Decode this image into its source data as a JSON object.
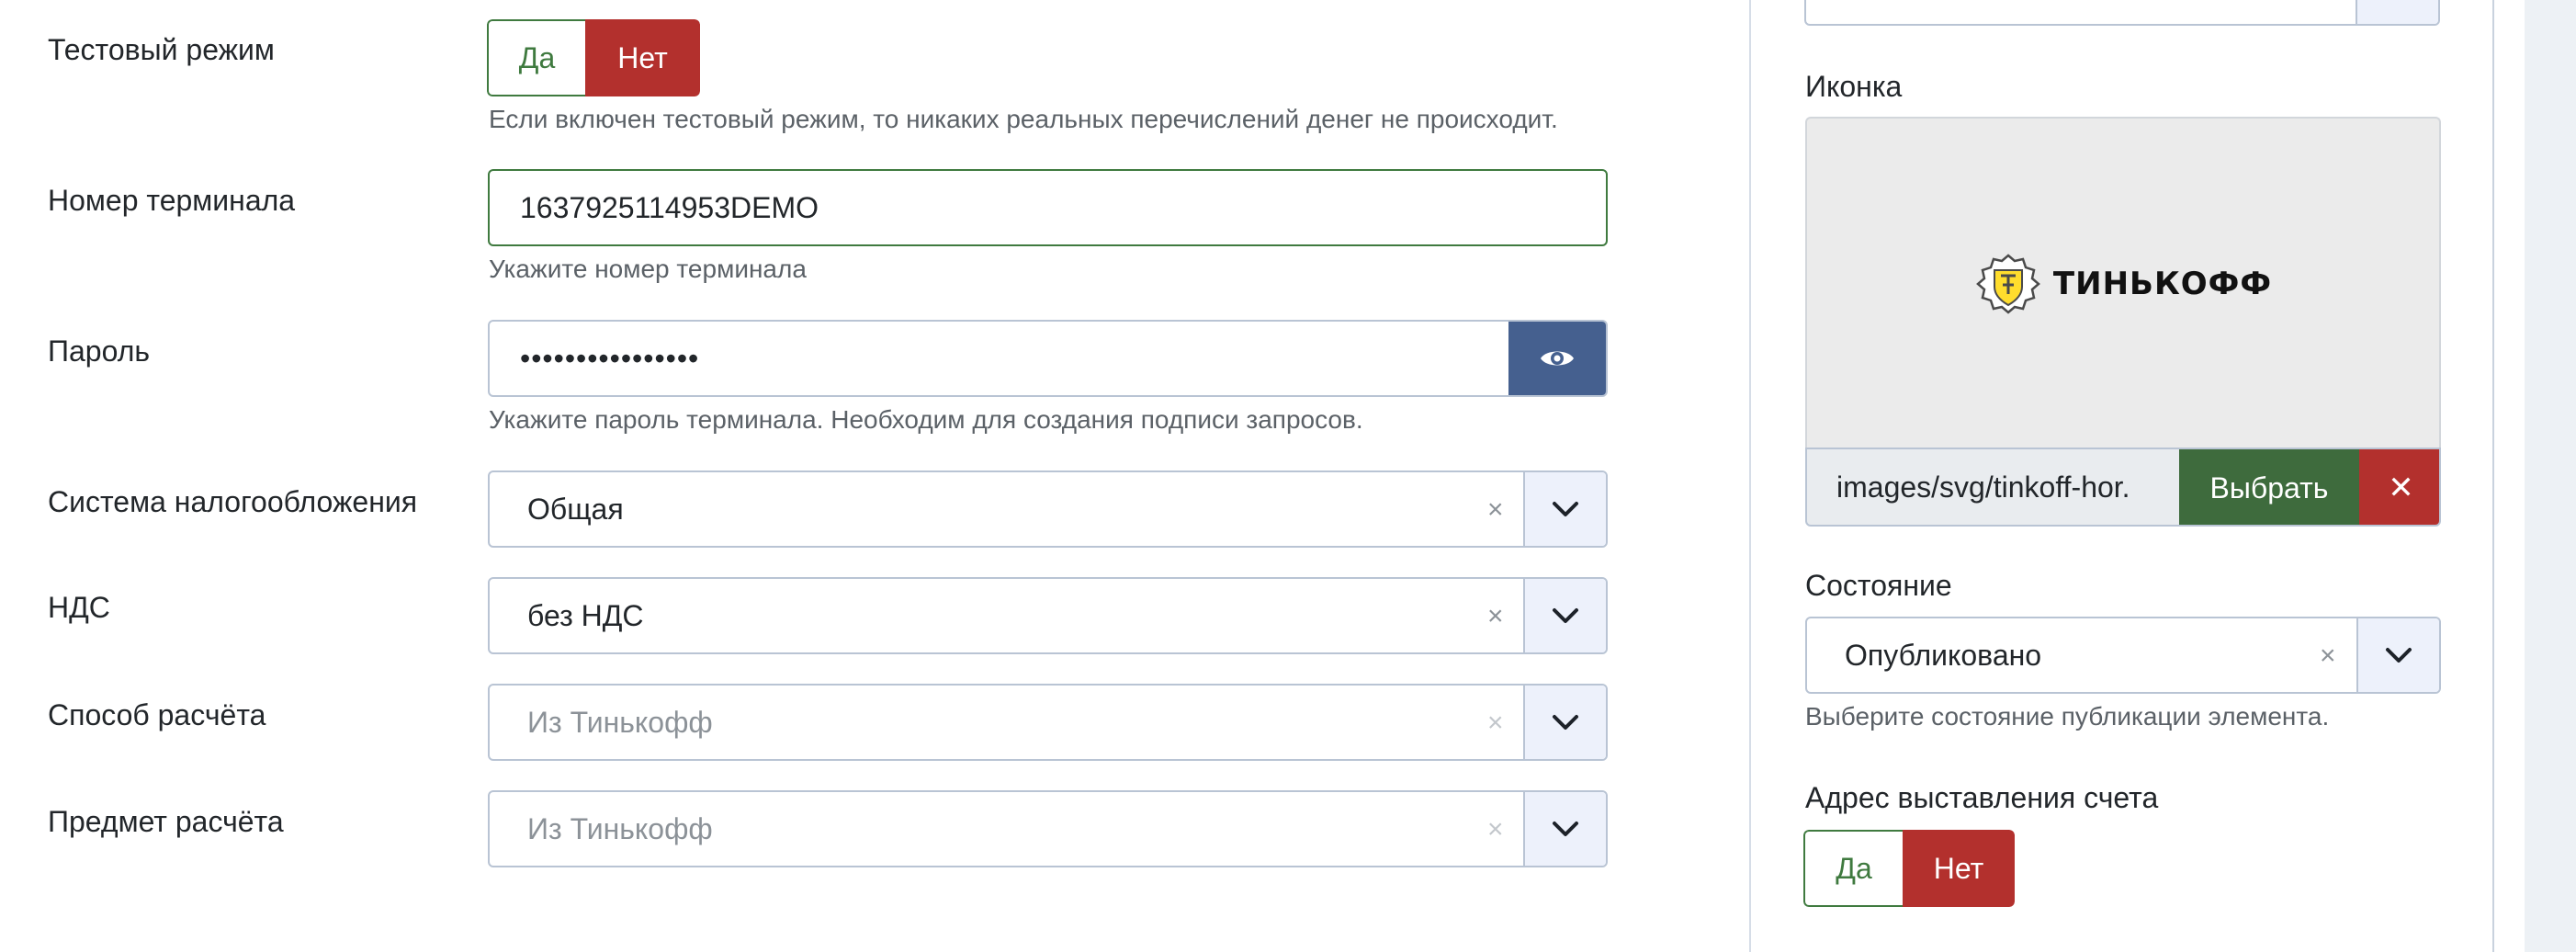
{
  "left": {
    "test_mode": {
      "label": "Тестовый режим",
      "yes": "Да",
      "no": "Нет",
      "hint": "Если включен тестовый режим, то никаких реальных перечислений денег не происходит."
    },
    "terminal": {
      "label": "Номер терминала",
      "value": "1637925114953DEMO",
      "hint": "Укажите номер терминала"
    },
    "password": {
      "label": "Пароль",
      "value": "••••••••••••••••",
      "hint": "Укажите пароль терминала. Необходим для создания подписи запросов."
    },
    "tax_system": {
      "label": "Система налогообложения",
      "value": "Общая"
    },
    "vat": {
      "label": "НДС",
      "value": "без НДС"
    },
    "payment_method": {
      "label": "Способ расчёта",
      "placeholder": "Из Тинькофф"
    },
    "payment_object": {
      "label": "Предмет расчёта",
      "placeholder": "Из Тинькофф"
    }
  },
  "right": {
    "icon": {
      "label": "Иконка",
      "preview_text": "ТИНЬКОФФ",
      "path": "images/svg/tinkoff-hor.",
      "select_label": "Выбрать",
      "clear_label": "✕"
    },
    "state": {
      "label": "Состояние",
      "value": "Опубликовано",
      "hint": "Выберите состояние публикации элемента."
    },
    "billing_address": {
      "label": "Адрес выставления счета",
      "yes": "Да",
      "no": "Нет"
    }
  },
  "colors": {
    "accent_green": "#3f7a3f",
    "accent_red": "#b3302d",
    "eye_button": "#45608f",
    "select_green": "#3e6b3d"
  },
  "icons": [
    "eye-icon",
    "chevron-down-icon",
    "clear-icon",
    "close-icon",
    "tinkoff-logo-icon"
  ]
}
